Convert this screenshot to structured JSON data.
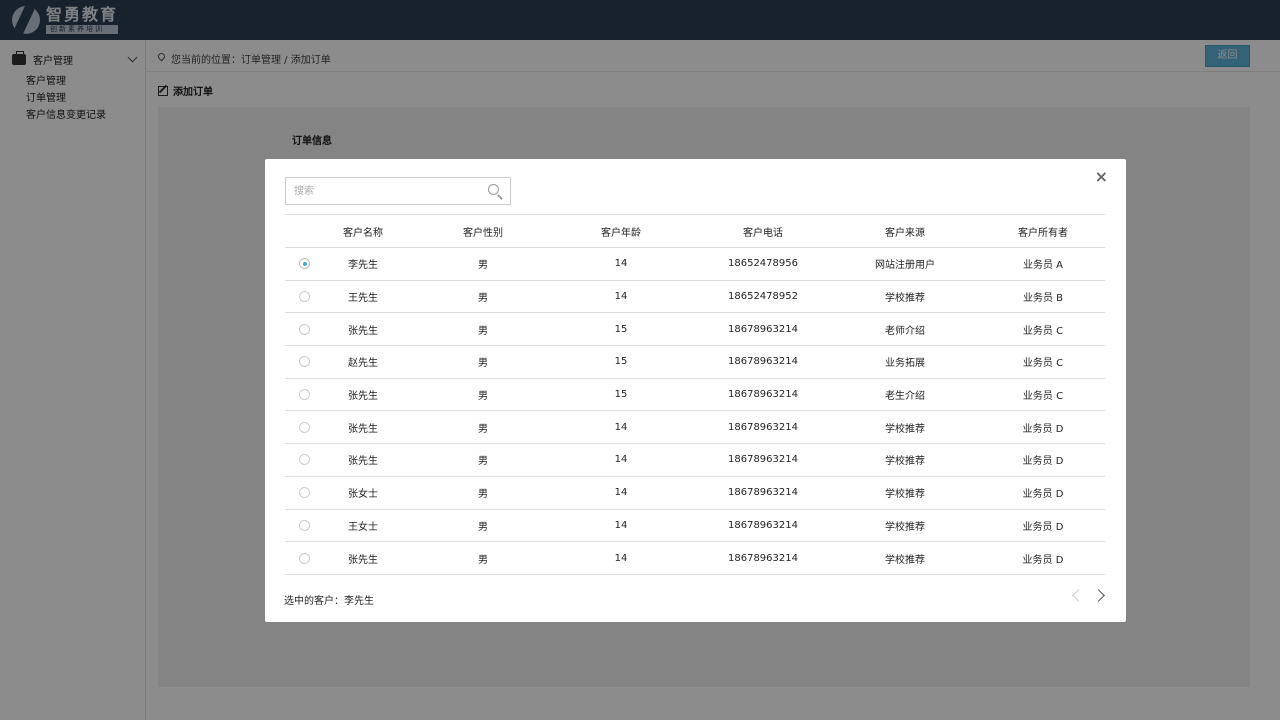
{
  "header": {
    "logo_title": "智勇教育",
    "logo_sub": "创新素养培训"
  },
  "sidebar": {
    "group_label": "客户管理",
    "items": [
      "客户管理",
      "订单管理",
      "客户信息变更记录"
    ]
  },
  "main": {
    "breadcrumb": "您当前的位置：订单管理 / 添加订单",
    "back_label": "返回",
    "section_title": "添加订单",
    "panel_label": "订单信息"
  },
  "modal": {
    "close_label": "×",
    "search_placeholder": "搜索",
    "columns": [
      "客户名称",
      "客户性别",
      "客户年龄",
      "客户电话",
      "客户来源",
      "客户所有者"
    ],
    "rows": [
      {
        "selected": true,
        "name": "李先生",
        "gender": "男",
        "age": "14",
        "phone": "18652478956",
        "source": "网站注册用户",
        "owner": "业务员 A"
      },
      {
        "selected": false,
        "name": "王先生",
        "gender": "男",
        "age": "14",
        "phone": "18652478952",
        "source": "学校推荐",
        "owner": "业务员 B"
      },
      {
        "selected": false,
        "name": "张先生",
        "gender": "男",
        "age": "15",
        "phone": "18678963214",
        "source": "老师介绍",
        "owner": "业务员 C"
      },
      {
        "selected": false,
        "name": "赵先生",
        "gender": "男",
        "age": "15",
        "phone": "18678963214",
        "source": "业务拓展",
        "owner": "业务员 C"
      },
      {
        "selected": false,
        "name": "张先生",
        "gender": "男",
        "age": "15",
        "phone": "18678963214",
        "source": "老生介绍",
        "owner": "业务员 C"
      },
      {
        "selected": false,
        "name": "张先生",
        "gender": "男",
        "age": "14",
        "phone": "18678963214",
        "source": "学校推荐",
        "owner": "业务员 D"
      },
      {
        "selected": false,
        "name": "张先生",
        "gender": "男",
        "age": "14",
        "phone": "18678963214",
        "source": "学校推荐",
        "owner": "业务员 D"
      },
      {
        "selected": false,
        "name": "张女士",
        "gender": "男",
        "age": "14",
        "phone": "18678963214",
        "source": "学校推荐",
        "owner": "业务员 D"
      },
      {
        "selected": false,
        "name": "王女士",
        "gender": "男",
        "age": "14",
        "phone": "18678963214",
        "source": "学校推荐",
        "owner": "业务员 D"
      },
      {
        "selected": false,
        "name": "张先生",
        "gender": "男",
        "age": "14",
        "phone": "18678963214",
        "source": "学校推荐",
        "owner": "业务员 D"
      }
    ],
    "selected_text": "选中的客户：李先生"
  },
  "colors": {
    "topbar": "#2c3e50",
    "accent": "#5fb3d7",
    "radio_checked": "#3aaed8"
  }
}
